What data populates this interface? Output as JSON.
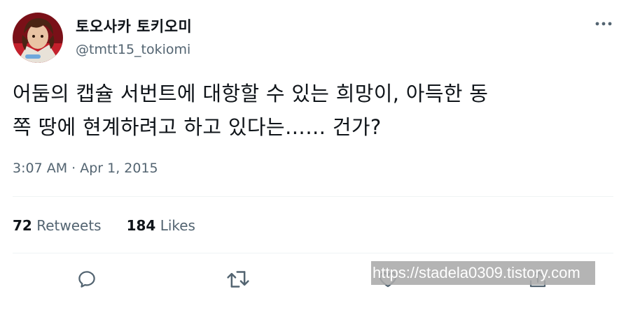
{
  "user": {
    "display_name": "토오사카 토키오미",
    "handle": "@tmtt15_tokiomi"
  },
  "tweet": {
    "line1": "어둠의 캡슐 서번트에 대항할 수 있는 희망이, 아득한 동",
    "line2": "쪽 땅에 현계하려고 하고 있다는…… 건가?",
    "timestamp": "3:07 AM · Apr 1, 2015"
  },
  "stats": {
    "retweets_count": "72",
    "retweets_label": "Retweets",
    "likes_count": "184",
    "likes_label": "Likes"
  },
  "actions": [
    "reply-icon",
    "retweet-icon",
    "like-icon",
    "share-icon"
  ],
  "more_icon": "more-icon",
  "watermark": "https://stadela0309.tistory.com",
  "colors": {
    "text_primary": "#0f1419",
    "text_secondary": "#536471",
    "icon": "#536471",
    "divider": "#eff3f4"
  }
}
